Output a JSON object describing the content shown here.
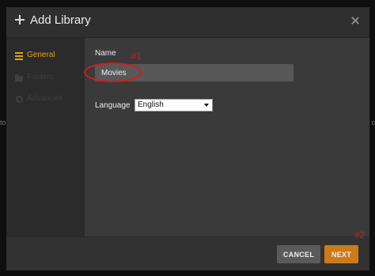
{
  "backdrop": {
    "left_text": "to",
    "right_text": "c"
  },
  "dialog": {
    "title": "Add Library",
    "add_icon": "plus-icon",
    "close_icon": "close-icon"
  },
  "sidebar": {
    "items": [
      {
        "label": "General",
        "icon": "general-icon",
        "state": "active"
      },
      {
        "label": "Folders",
        "icon": "folder-icon",
        "state": "disabled"
      },
      {
        "label": "Advanced",
        "icon": "gear-icon",
        "state": "disabled"
      }
    ]
  },
  "form": {
    "name_label": "Name",
    "name_value": "Movies",
    "language_label": "Language",
    "language_value": "English"
  },
  "annotations": {
    "first": "#1",
    "second": "#2",
    "color": "#d41a1a"
  },
  "footer": {
    "cancel_label": "CANCEL",
    "next_label": "NEXT"
  },
  "colors": {
    "accent": "#e5a00d",
    "next_button": "#cc7b19"
  }
}
